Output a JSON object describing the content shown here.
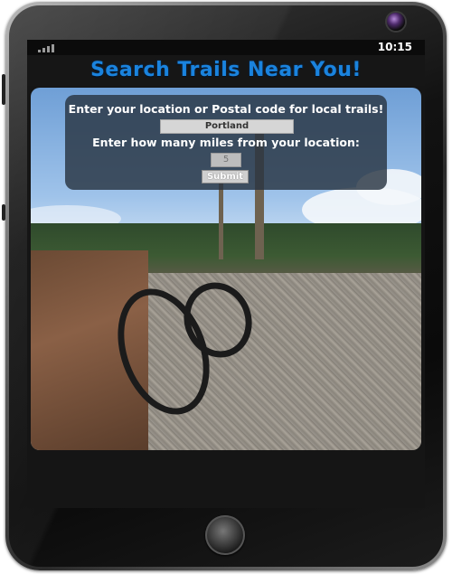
{
  "status_bar": {
    "time": "10:15",
    "signal_icon": "signal-bars-icon"
  },
  "header": {
    "title": "Search Trails Near You!"
  },
  "form": {
    "location_prompt": "Enter your location or Postal code for local trails!",
    "location_value": "Portland",
    "miles_prompt": "Enter how many miles from your location:",
    "miles_placeholder": "5",
    "submit_label": "Submit"
  },
  "colors": {
    "title": "#1a83de",
    "panel": "#28344a"
  }
}
